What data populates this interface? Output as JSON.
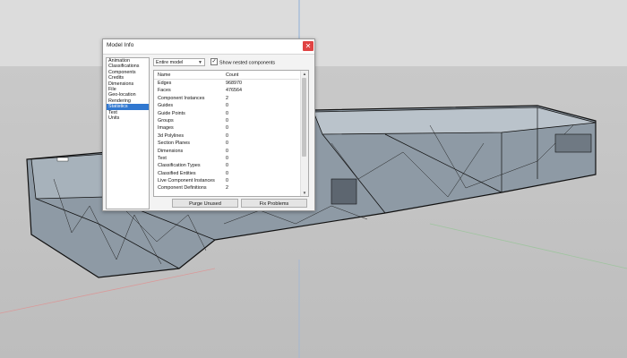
{
  "dialog": {
    "title": "Model Info",
    "categories": [
      "Animation",
      "Classifications",
      "Components",
      "Credits",
      "Dimensions",
      "File",
      "Geo-location",
      "Rendering",
      "Statistics",
      "Text",
      "Units"
    ],
    "selected_category": "Statistics",
    "scope_select": "Entire model",
    "show_nested_label": "Show nested components",
    "show_nested_checked": true,
    "columns": {
      "name": "Name",
      "count": "Count"
    },
    "stats": [
      {
        "name": "Edges",
        "count": "968970"
      },
      {
        "name": "Faces",
        "count": "476564"
      },
      {
        "name": "Component Instances",
        "count": "2"
      },
      {
        "name": "Guides",
        "count": "0"
      },
      {
        "name": "Guide Points",
        "count": "0"
      },
      {
        "name": "Groups",
        "count": "0"
      },
      {
        "name": "Images",
        "count": "0"
      },
      {
        "name": "3d Polylines",
        "count": "0"
      },
      {
        "name": "Section Planes",
        "count": "0"
      },
      {
        "name": "Dimensions",
        "count": "0"
      },
      {
        "name": "Text",
        "count": "0"
      },
      {
        "name": "Classification Types",
        "count": "0"
      },
      {
        "name": "Classified Entities",
        "count": "0"
      },
      {
        "name": "Live Component Instances",
        "count": "0"
      },
      {
        "name": "Component Definitions",
        "count": "2"
      }
    ],
    "purge_label": "Purge Unused",
    "fix_label": "Fix Problems"
  },
  "colors": {
    "selection": "#3178d0",
    "close": "#e04343",
    "model": "#8e9aa5"
  }
}
